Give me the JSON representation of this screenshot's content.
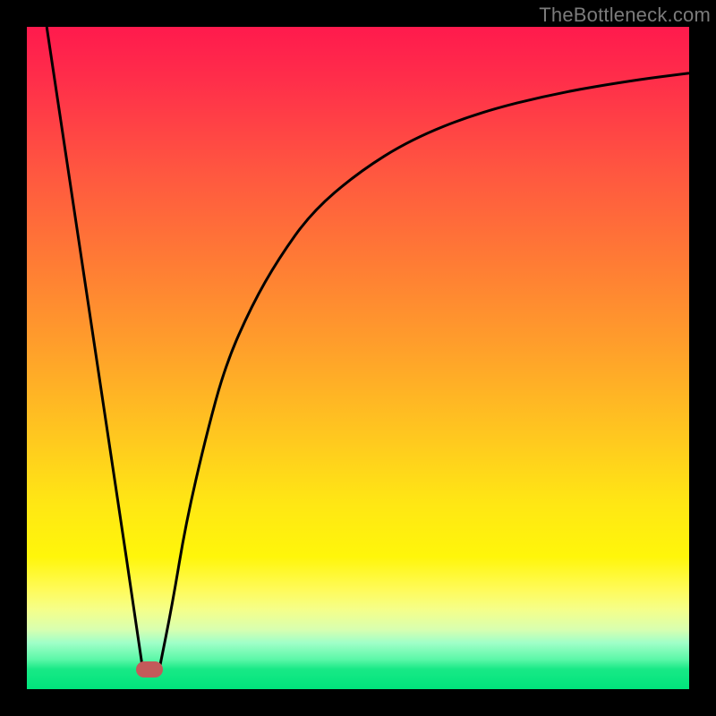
{
  "watermark": "TheBottleneck.com",
  "colors": {
    "frame": "#000000",
    "curve": "#000000",
    "marker": "#c35a5a",
    "gradient_top": "#ff1a4d",
    "gradient_bottom": "#00e47c"
  },
  "chart_data": {
    "type": "line",
    "title": "",
    "xlabel": "",
    "ylabel": "",
    "xlim": [
      0,
      100
    ],
    "ylim": [
      0,
      100
    ],
    "grid": false,
    "series": [
      {
        "name": "left-branch",
        "x": [
          3,
          6,
          9,
          12,
          15,
          17.5
        ],
        "y": [
          100,
          80,
          60,
          40,
          20,
          3
        ]
      },
      {
        "name": "right-branch",
        "x": [
          20,
          22,
          24,
          27,
          30,
          34,
          38,
          43,
          50,
          58,
          68,
          80,
          92,
          100
        ],
        "y": [
          3,
          13,
          25,
          38,
          49,
          58,
          65,
          72,
          78,
          83,
          87,
          90,
          92,
          93
        ]
      }
    ],
    "marker": {
      "x": 18.5,
      "y": 3
    },
    "background_bands": [
      {
        "y": 100,
        "color": "#ff1a4d"
      },
      {
        "y": 80,
        "color": "#ff9e2b"
      },
      {
        "y": 50,
        "color": "#ffe714"
      },
      {
        "y": 15,
        "color": "#fffb5a"
      },
      {
        "y": 6,
        "color": "#5cf7a8"
      },
      {
        "y": 0,
        "color": "#00e47c"
      }
    ]
  }
}
